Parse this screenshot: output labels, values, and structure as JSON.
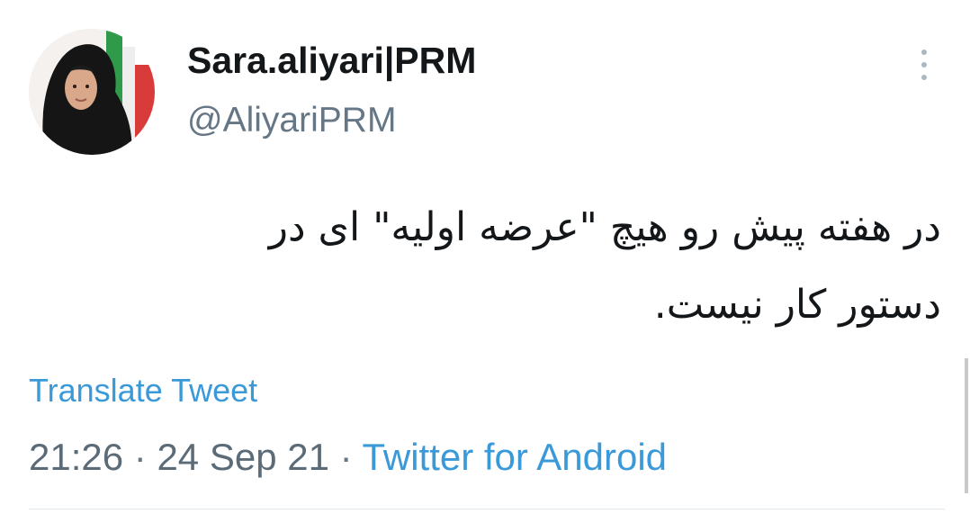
{
  "author": {
    "display_name": "Sara.aliyari|PRM",
    "handle": "@AliyariPRM",
    "avatar_icon": "profile-photo"
  },
  "menu": {
    "icon": "more-vertical-icon"
  },
  "tweet": {
    "text_line_1": "در هفته پیش رو هیچ \"عرضه اولیه\" ای در",
    "text_line_2": "دستور کار نیست."
  },
  "translate": {
    "label": "Translate Tweet"
  },
  "meta": {
    "time": "21:26",
    "date": "24 Sep 21",
    "separator": "·",
    "source": "Twitter for Android"
  },
  "colors": {
    "link": "#3a99d8",
    "text": "#14171a",
    "muted": "#657786"
  }
}
